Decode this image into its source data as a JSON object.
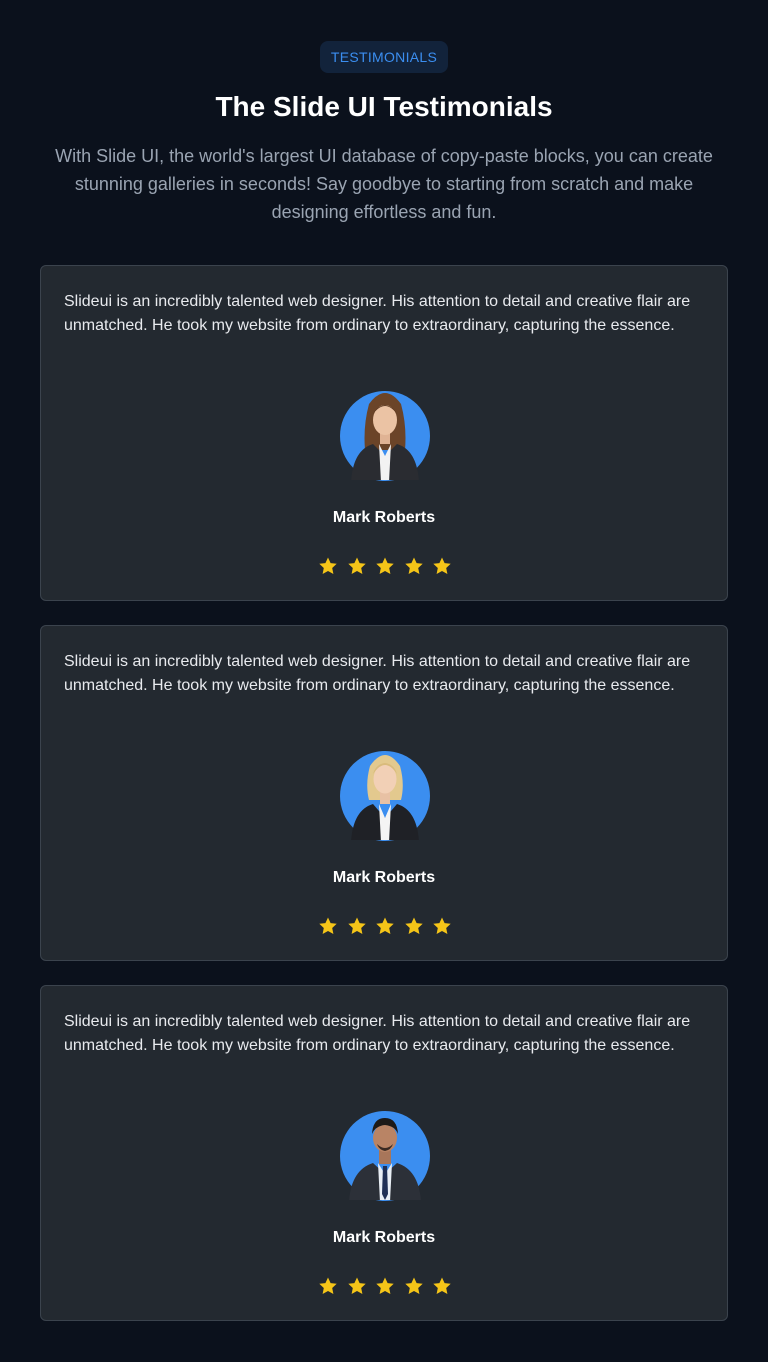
{
  "header": {
    "badge": "TESTIMONIALS",
    "title": "The Slide UI Testimonials",
    "subtitle": "With Slide UI, the world's largest UI database of copy-paste blocks, you can create stunning galleries in seconds! Say goodbye to starting from scratch and make designing effortless and fun."
  },
  "colors": {
    "background": "#0b111c",
    "card": "#232930",
    "accent": "#3b8ef0",
    "avatar_bg": "#3b8ef0",
    "star": "#f5c518"
  },
  "testimonials": [
    {
      "quote": "Slideui is an incredibly talented web designer. His attention to detail and creative flair are unmatched. He took my website from ordinary to extraordinary, capturing the essence.",
      "name": "Mark Roberts",
      "rating": 5,
      "avatar_icon": "woman-brown-hair-avatar-icon"
    },
    {
      "quote": "Slideui is an incredibly talented web designer. His attention to detail and creative flair are unmatched. He took my website from ordinary to extraordinary, capturing the essence.",
      "name": "Mark Roberts",
      "rating": 5,
      "avatar_icon": "woman-blonde-hair-avatar-icon"
    },
    {
      "quote": "Slideui is an incredibly talented web designer. His attention to detail and creative flair are unmatched. He took my website from ordinary to extraordinary, capturing the essence.",
      "name": "Mark Roberts",
      "rating": 5,
      "avatar_icon": "man-suit-avatar-icon"
    }
  ],
  "star_icon": "star-icon"
}
